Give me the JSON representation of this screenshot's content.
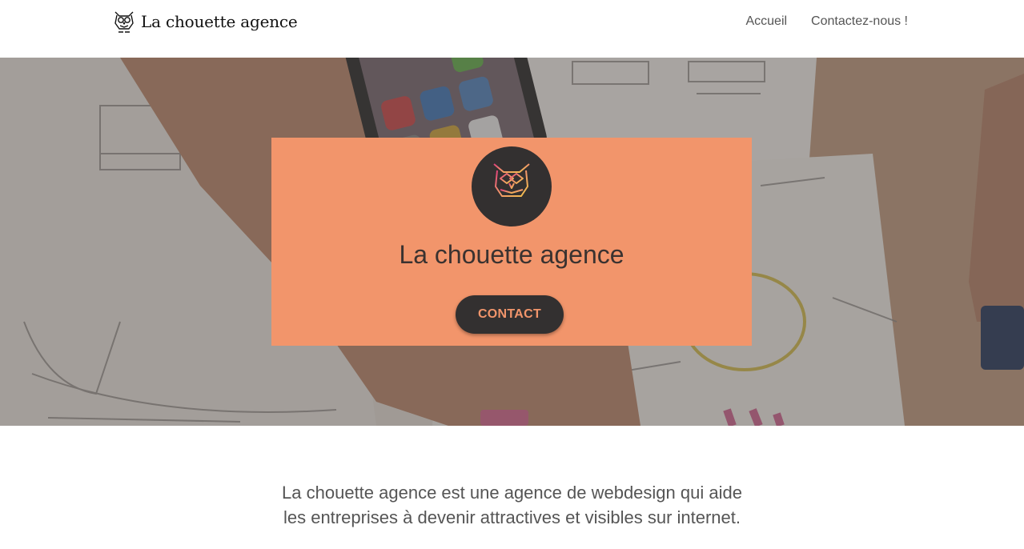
{
  "header": {
    "brand_name": "La chouette agence",
    "nav": [
      {
        "label": "Accueil"
      },
      {
        "label": "Contactez-nous !"
      }
    ]
  },
  "hero": {
    "title": "La chouette agence",
    "button_label": "CONTACT",
    "card_color": "#f2956b",
    "badge_color": "#333030",
    "background_image": "photo of hands sketching wireframes on paper next to a smartphone, darkened overlay",
    "icons": [
      "owl-logo-icon"
    ]
  },
  "intro": {
    "lines": [
      "La chouette agence est une agence de webdesign qui aide",
      "les entreprises à devenir attractives et visibles sur internet."
    ]
  }
}
